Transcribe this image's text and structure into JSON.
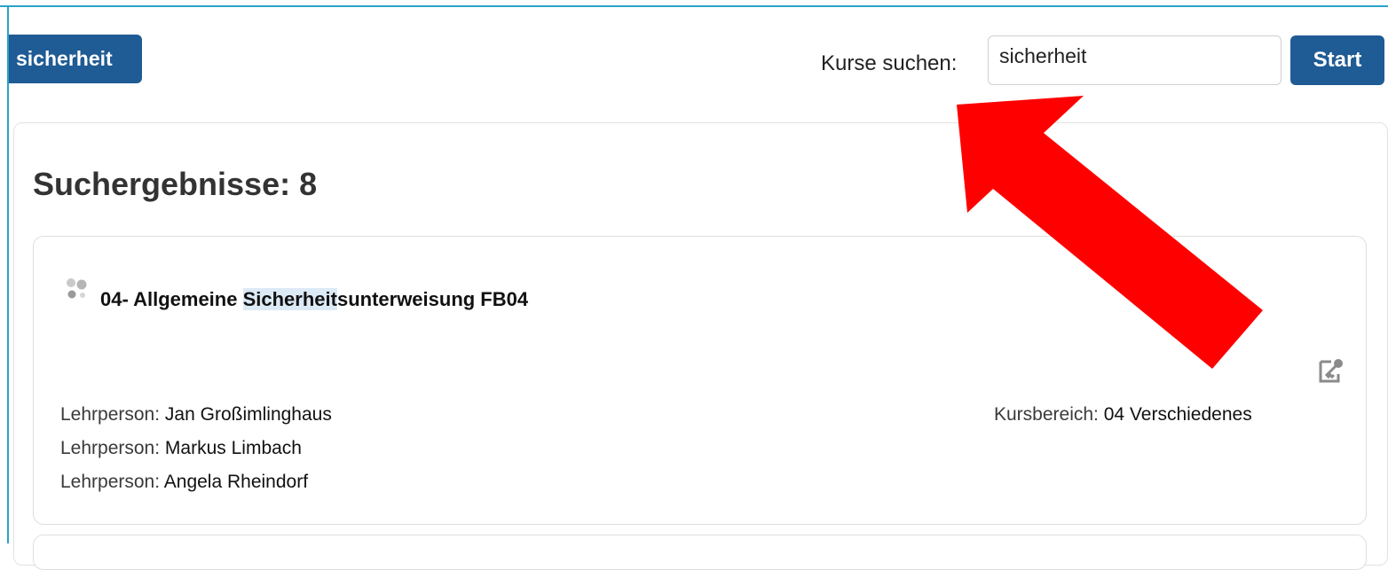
{
  "active_filter": {
    "label": "sicherheit"
  },
  "search": {
    "label": "Kurse suchen:",
    "value": "sicherheit",
    "button_label": "Start"
  },
  "results": {
    "title": "Suchergebnisse: 8"
  },
  "course": {
    "title_prefix": "04- Allgemeine ",
    "title_highlight": "Sicherheit",
    "title_suffix": "sunterweisung FB04",
    "teachers": [
      {
        "label": "Lehrperson:",
        "name": "Jan Großimlinghaus"
      },
      {
        "label": "Lehrperson:",
        "name": "Markus Limbach"
      },
      {
        "label": "Lehrperson:",
        "name": "Angela Rheindorf"
      }
    ],
    "category_label": "Kursbereich:",
    "category_value": "04 Verschiedenes",
    "course_icon": "course-bubbles-icon",
    "enroll_icon": "self-enrol-key-icon"
  },
  "annotation": {
    "color": "#ff0000",
    "icon": "red-arrow"
  },
  "colors": {
    "accent": "#1f5b94",
    "highlight": "#dceaf6",
    "frame": "#2aa3c9"
  }
}
